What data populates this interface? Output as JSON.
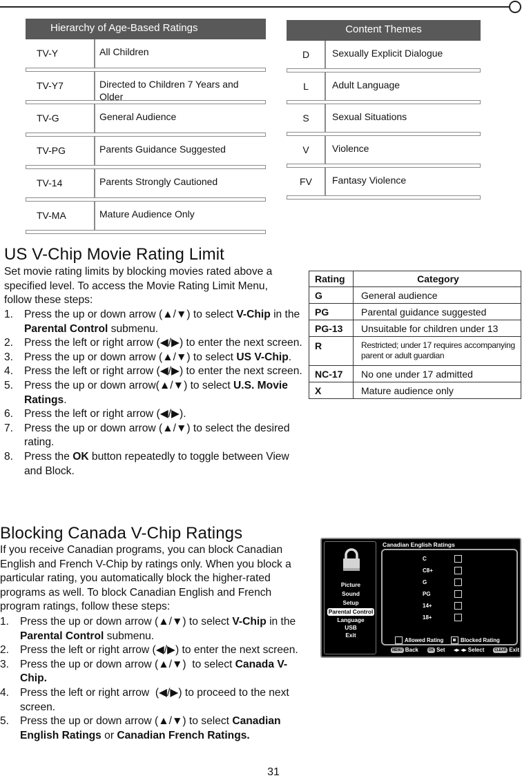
{
  "age_table": {
    "title": "Hierarchy of Age-Based Ratings",
    "rows": [
      {
        "code": "TV-Y",
        "desc": "All Children"
      },
      {
        "code": "TV-Y7",
        "desc": "Directed to Children 7 Years and Older"
      },
      {
        "code": "TV-G",
        "desc": "General Audience"
      },
      {
        "code": "TV-PG",
        "desc": "Parents Guidance Suggested"
      },
      {
        "code": "TV-14",
        "desc": "Parents Strongly Cautioned"
      },
      {
        "code": "TV-MA",
        "desc": "Mature Audience Only"
      }
    ]
  },
  "theme_table": {
    "title": "Content Themes",
    "rows": [
      {
        "code": "D",
        "desc": "Sexually Explicit Dialogue"
      },
      {
        "code": "L",
        "desc": "Adult Language"
      },
      {
        "code": "S",
        "desc": "Sexual Situations"
      },
      {
        "code": "V",
        "desc": "Violence"
      },
      {
        "code": "FV",
        "desc": "Fantasy Violence"
      }
    ]
  },
  "us_section": {
    "heading": "US V-Chip Movie Rating Limit",
    "intro": "Set movie rating limits by blocking movies rated above a specified level. To access the Movie Rating Limit Menu, follow these steps:",
    "steps": [
      {
        "num": "1.",
        "html": "Press the up or down arrow (▲/▼) to select <b>V-Chip</b> in the <b>Parental Control</b> submenu."
      },
      {
        "num": "2.",
        "html": "Press the left or right arrow (◀/▶) to enter the next screen."
      },
      {
        "num": "3.",
        "html": "Press the up or down arrow (▲/▼) to select <b>US V-Chip</b>."
      },
      {
        "num": "4.",
        "html": "Press the left or right arrow (◀/▶) to enter the next screen."
      },
      {
        "num": "5.",
        "html": "Press the up or down arrow(▲/▼) to select <b>U.S. Movie Ratings</b>."
      },
      {
        "num": "6.",
        "html": "Press the left or right arrow (◀/▶)."
      },
      {
        "num": "7.",
        "html": "Press the up or down arrow (▲/▼) to select the desired rating."
      },
      {
        "num": "8.",
        "html": "Press the <b>OK</b> button repeatedly to toggle between View and Block."
      }
    ]
  },
  "movie_table": {
    "headers": [
      "Rating",
      "Category"
    ],
    "rows": [
      {
        "rating": "G",
        "category": "General audience"
      },
      {
        "rating": "PG",
        "category": "Parental guidance suggested"
      },
      {
        "rating": "PG-13",
        "category": "Unsuitable for children under 13"
      },
      {
        "rating": "R",
        "category": "Restricted; under 17 requires accompanying parent or adult guardian"
      },
      {
        "rating": "NC-17",
        "category": "No one under 17 admitted"
      },
      {
        "rating": "X",
        "category": "Mature audience only"
      }
    ]
  },
  "canada_section": {
    "heading": "Blocking Canada V-Chip Ratings",
    "intro": "If you receive Canadian programs, you can block Canadian English and French V-Chip by ratings only. When you block a particular rating, you automatically block the higher-rated programs as well. To block Canadian English and French program ratings, follow these steps:",
    "steps": [
      {
        "num": "1.",
        "html": "Press the up or down arrow (▲/▼) to select <b>V-Chip</b> in the <b>Parental Control</b> submenu."
      },
      {
        "num": "2.",
        "html": "Press the left or right arrow (◀/▶) to enter the next screen."
      },
      {
        "num": "3.",
        "html": "Press the up or down arrow (▲/▼)&nbsp; to select <b>Canada V-Chip.</b>"
      },
      {
        "num": "4.",
        "html": "Press the left or right arrow&nbsp; (◀/▶) to proceed to the next screen."
      },
      {
        "num": "5.",
        "html": "Press the up or down arrow (▲/▼) to select <b>Canadian English Ratings</b> or <b>Canadian French Ratings.</b>"
      }
    ]
  },
  "tv_screen": {
    "menu": [
      "Picture",
      "Sound",
      "Setup",
      "Parental Control",
      "Language",
      "USB",
      "Exit"
    ],
    "selected_menu": "Parental Control",
    "title": "Canadian English Ratings",
    "ratings": [
      {
        "label": "C",
        "blocked": false
      },
      {
        "label": "C8+",
        "blocked": false
      },
      {
        "label": "G",
        "blocked": false
      },
      {
        "label": "PG",
        "blocked": false
      },
      {
        "label": "14+",
        "blocked": false
      },
      {
        "label": "18+",
        "blocked": false
      }
    ],
    "legend_allowed": "Allowed Rating",
    "legend_blocked": "Blocked Rating",
    "footer": {
      "menu_key": "MENU",
      "back": "Back",
      "ok_key": "OK",
      "set": "Set",
      "select_arrows": "◂▸ ◂▸",
      "select": "Select",
      "clear_key": "CLEAR",
      "exit": "Exit"
    }
  },
  "page_number": "31"
}
